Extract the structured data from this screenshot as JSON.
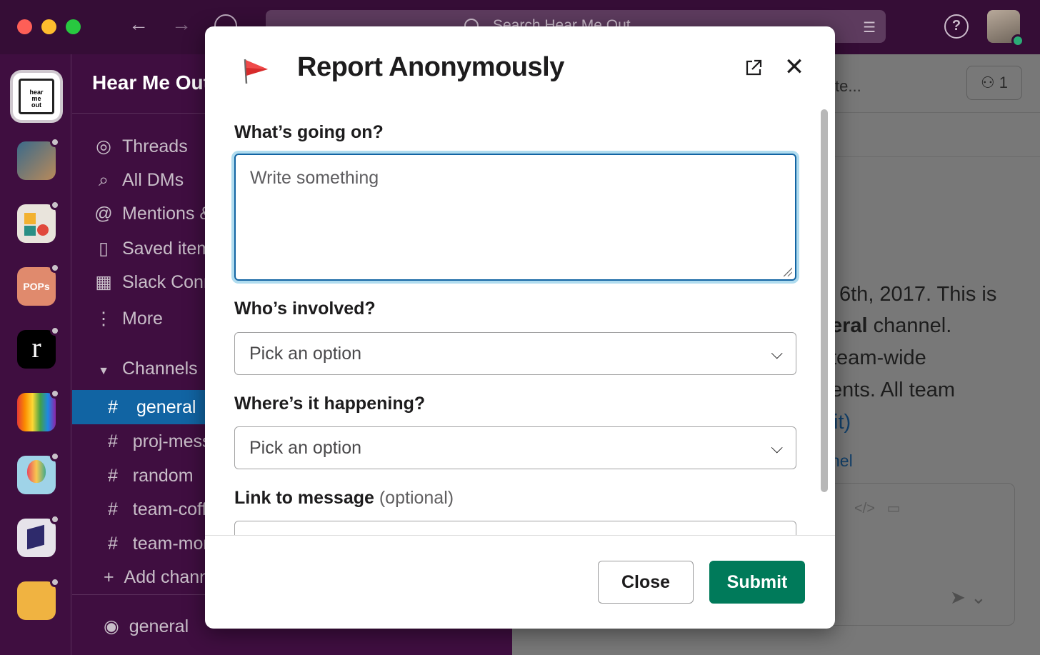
{
  "topbar": {
    "search_placeholder": "Search Hear Me Out"
  },
  "sidebar": {
    "workspace_name": "Hear Me Out",
    "items": [
      {
        "label": "Threads",
        "icon": "threads-icon"
      },
      {
        "label": "All DMs",
        "icon": "dms-icon"
      },
      {
        "label": "Mentions & reactions",
        "icon": "at-icon"
      },
      {
        "label": "Saved items",
        "icon": "bookmark-icon"
      },
      {
        "label": "Slack Connect",
        "icon": "building-icon"
      },
      {
        "label": "More",
        "icon": "more-icon"
      }
    ],
    "channels_heading": "Channels",
    "channels": [
      "general",
      "proj-messages",
      "random",
      "team-coffee",
      "team-moments"
    ],
    "add_channel": "Add channels",
    "huddle_channel": "general"
  },
  "main": {
    "header_partial": "te...",
    "member_count": "1",
    "lines": [
      "6th, 2017. This is",
      "eral channel.",
      "team-wide",
      "ents. All team",
      "it)",
      "nel"
    ],
    "bold_word": "eral",
    "bold_rest": " channel."
  },
  "modal": {
    "title": "Report Anonymously",
    "fields": {
      "whats_going_on_label": "What’s going on?",
      "whats_going_on_placeholder": "Write something",
      "whos_involved_label": "Who’s involved?",
      "whos_involved_value": "Pick an option",
      "where_label": "Where’s it happening?",
      "where_value": "Pick an option",
      "link_label": "Link to message",
      "link_optional": "(optional)"
    },
    "buttons": {
      "close": "Close",
      "submit": "Submit"
    }
  },
  "colors": {
    "submit_green": "#007a5a",
    "focus_blue": "#1264a3",
    "sidebar_bg": "#3f0e40",
    "active_channel": "#1164a3"
  }
}
